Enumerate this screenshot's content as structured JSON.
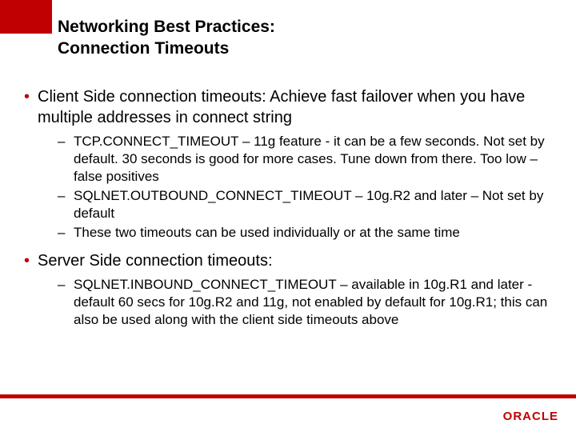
{
  "title": {
    "line1": "Networking Best Practices:",
    "line2": "Connection Timeouts"
  },
  "bullets": [
    {
      "text": "Client Side connection timeouts: Achieve fast failover when you have multiple addresses in connect string",
      "subs": [
        "TCP.CONNECT_TIMEOUT – 11g feature -  it can be a few seconds. Not set by default. 30 seconds is good for more cases. Tune down from there. Too low – false positives",
        "SQLNET.OUTBOUND_CONNECT_TIMEOUT – 10g.R2 and later – Not set by default",
        "These two timeouts can be used individually or at the same time"
      ]
    },
    {
      "text": "Server Side connection timeouts:",
      "subs": [
        "SQLNET.INBOUND_CONNECT_TIMEOUT – available in 10g.R1 and later - default 60 secs for 10g.R2 and 11g, not enabled by default for 10g.R1; this can also be used along with the client side timeouts above"
      ]
    }
  ],
  "footer": {
    "logo": "ORACLE"
  }
}
